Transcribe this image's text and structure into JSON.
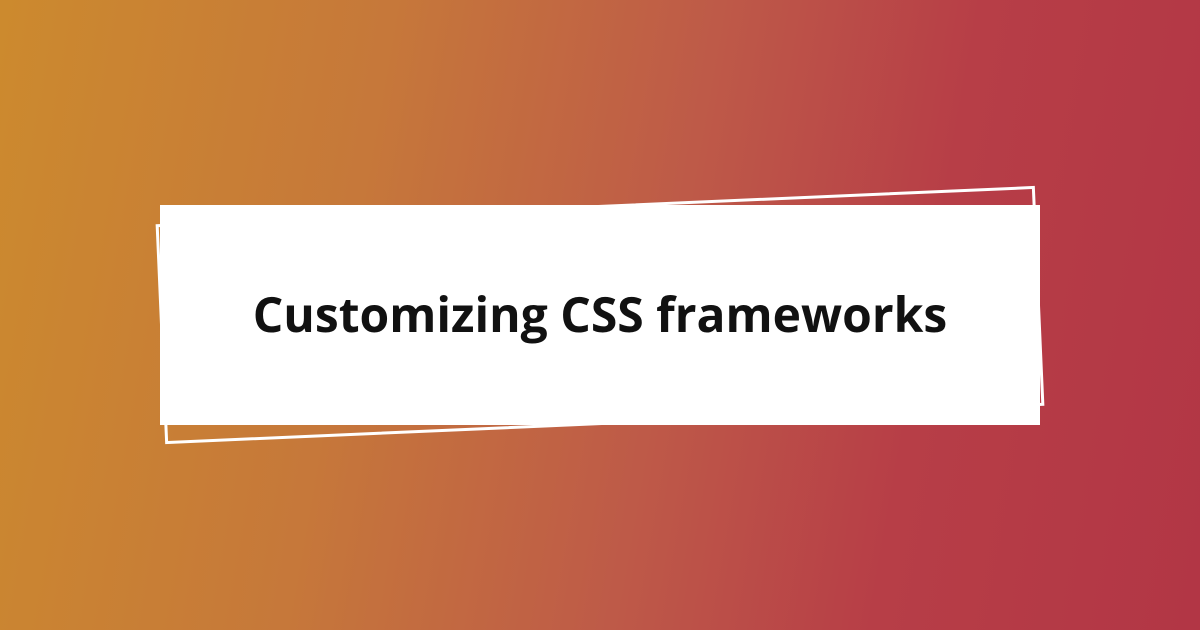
{
  "card": {
    "title": "Customizing CSS frameworks"
  }
}
